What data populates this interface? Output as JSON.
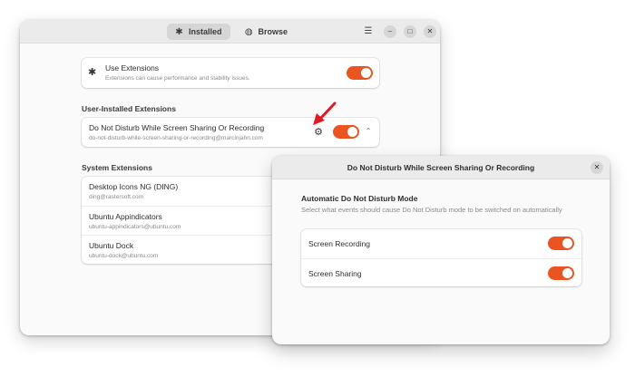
{
  "main_window": {
    "tabs": [
      {
        "label": "Installed",
        "icon": "puzzle-icon",
        "active": true
      },
      {
        "label": "Browse",
        "icon": "globe-icon",
        "active": false
      }
    ],
    "use_extensions": {
      "title": "Use Extensions",
      "subtitle": "Extensions can cause performance and stability issues.",
      "enabled": true
    },
    "user_section_label": "User-Installed Extensions",
    "user_extensions": [
      {
        "name": "Do Not Disturb While Screen Sharing Or Recording",
        "id": "do-not-disturb-while-screen-sharing-or-recording@marcinjahn.com",
        "enabled": true
      }
    ],
    "system_section_label": "System Extensions",
    "system_extensions": [
      {
        "name": "Desktop Icons NG (DING)",
        "id": "ding@rastersoft.com"
      },
      {
        "name": "Ubuntu Appindicators",
        "id": "ubuntu-appindicators@ubuntu.com"
      },
      {
        "name": "Ubuntu Dock",
        "id": "ubuntu-dock@ubuntu.com"
      }
    ]
  },
  "prefs_window": {
    "title": "Do Not Disturb While Screen Sharing Or Recording",
    "group_title": "Automatic Do Not Disturb Mode",
    "group_description": "Select what events should cause Do Not Disturb mode to be switched on automatically",
    "options": [
      {
        "label": "Screen Recording",
        "enabled": true
      },
      {
        "label": "Screen Sharing",
        "enabled": true
      }
    ]
  },
  "colors": {
    "accent": "#e95420",
    "annotation_arrow": "#e01b24"
  }
}
